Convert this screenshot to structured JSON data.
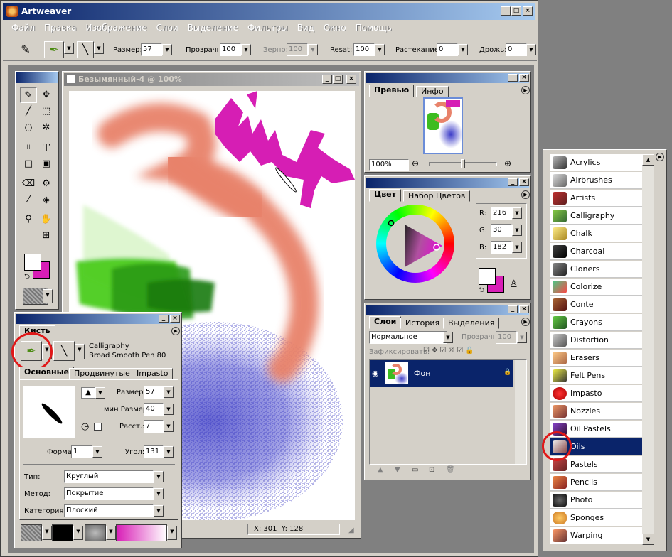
{
  "app": {
    "title": "Artweaver"
  },
  "menu": [
    "Файл",
    "Правка",
    "Изображение",
    "Слои",
    "Выделение",
    "Фильтры",
    "Вид",
    "Окно",
    "Помощь"
  ],
  "toolbar": {
    "size_label": "Размер:",
    "size_value": "57",
    "opacity_label": "Прозрачн:",
    "opacity_value": "100",
    "grain_label": "Зерно:",
    "grain_value": "100",
    "resat_label": "Resat:",
    "resat_value": "100",
    "bleed_label": "Растекание:",
    "bleed_value": "0",
    "jitter_label": "Дрожь:",
    "jitter_value": "0"
  },
  "document": {
    "title": "Безымянный-4 @ 100%",
    "status": "X: 301  Y: 128"
  },
  "preview": {
    "tab_preview": "Превью",
    "tab_info": "Инфо",
    "zoom": "100%"
  },
  "color": {
    "tab_color": "Цвет",
    "tab_swatches": "Набор Цветов",
    "r_label": "R:",
    "r": "216",
    "g_label": "G:",
    "g": "30",
    "b_label": "B:",
    "b": "182",
    "fg": "#d81eb6"
  },
  "layers": {
    "tab_layers": "Слои",
    "tab_history": "История",
    "tab_selections": "Выделения",
    "blend_mode": "Нормальное",
    "opacity_label": "Прозрачн:",
    "opacity": "100",
    "lock_label": "Зафиксировать:",
    "layer_name": "Фон"
  },
  "brush": {
    "title": "Кисть",
    "category": "Calligraphy",
    "variant": "Broad Smooth Pen 80",
    "tab_basic": "Основные",
    "tab_advanced": "Продвинутые",
    "tab_impasto": "Impasto",
    "size_label": "Размер:",
    "size": "57",
    "min_size_label": "мин Размер:",
    "min_size": "40",
    "spacing_label": "Расст.:",
    "spacing": "7",
    "shape_label": "Форма:",
    "shape": "1",
    "angle_label": "Угол:",
    "angle": "131",
    "type_label": "Тип:",
    "type": "Круглый",
    "method_label": "Метод:",
    "method": "Покрытие",
    "cat_label": "Категория:",
    "cat": "Плоский"
  },
  "brush_list": {
    "items": [
      "Acrylics",
      "Airbrushes",
      "Artists",
      "Calligraphy",
      "Chalk",
      "Charcoal",
      "Cloners",
      "Colorize",
      "Conte",
      "Crayons",
      "Distortion",
      "Erasers",
      "Felt Pens",
      "Impasto",
      "Nozzles",
      "Oil Pastels",
      "Oils",
      "Pastels",
      "Pencils",
      "Photo",
      "Sponges",
      "Warping"
    ],
    "selected": "Oils"
  }
}
